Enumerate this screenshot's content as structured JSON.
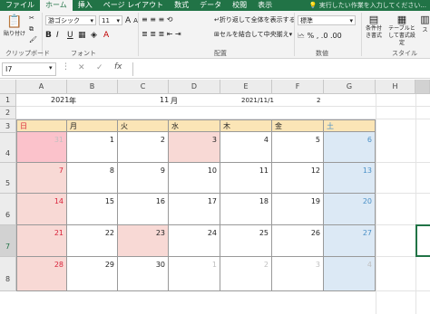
{
  "tabs": [
    "ファイル",
    "ホーム",
    "挿入",
    "ページ レイアウト",
    "数式",
    "データ",
    "校閲",
    "表示"
  ],
  "active_tab": "ホーム",
  "tellme": "実行したい作業を入力してください...",
  "ribbon": {
    "paste_label": "貼り付け",
    "font_name": "游ゴシック",
    "font_size": "11",
    "grow_font": "A",
    "shrink_font": "A",
    "bold": "B",
    "italic": "I",
    "underline": "U",
    "wrap_text": "折り返して全体を表示する",
    "merge_center": "セルを結合して中央揃え",
    "number_format": "標準",
    "cond_format": "条件付き書式",
    "format_table": "テーブルとして書式設定",
    "cell_styles": "ス",
    "groups": {
      "clipboard": "クリップボード",
      "font": "フォント",
      "align": "配置",
      "number": "数値",
      "styles": "スタイル"
    }
  },
  "formula_bar": {
    "namebox": "I7",
    "fx": "fx",
    "cancel": "✕",
    "enter": "✓"
  },
  "columns": [
    "A",
    "B",
    "C",
    "D",
    "E",
    "F",
    "G",
    "H"
  ],
  "rows": [
    "1",
    "2",
    "3",
    "4",
    "5",
    "6",
    "7",
    "8"
  ],
  "selected_cell": "I7",
  "row1": {
    "a_value": "2021",
    "a_label": "年",
    "d_value": "11",
    "d_label": "月",
    "date": "2021/11/1",
    "num": "2"
  },
  "weekdays": [
    "日",
    "月",
    "火",
    "水",
    "木",
    "金",
    "土"
  ],
  "weeks": [
    [
      "31",
      "1",
      "2",
      "3",
      "4",
      "5",
      "6"
    ],
    [
      "7",
      "8",
      "9",
      "10",
      "11",
      "12",
      "13"
    ],
    [
      "14",
      "15",
      "16",
      "17",
      "18",
      "19",
      "20"
    ],
    [
      "21",
      "22",
      "23",
      "24",
      "25",
      "26",
      "27"
    ],
    [
      "28",
      "29",
      "30",
      "1",
      "2",
      "3",
      "4"
    ]
  ],
  "colors": {
    "excel_green": "#217346",
    "header_fill": "#fbe5b6",
    "holiday_fill": "#f8d9d5",
    "saturday_fill": "#dce9f5",
    "sunday_text": "#d9243b",
    "saturday_text": "#4a90c7"
  }
}
